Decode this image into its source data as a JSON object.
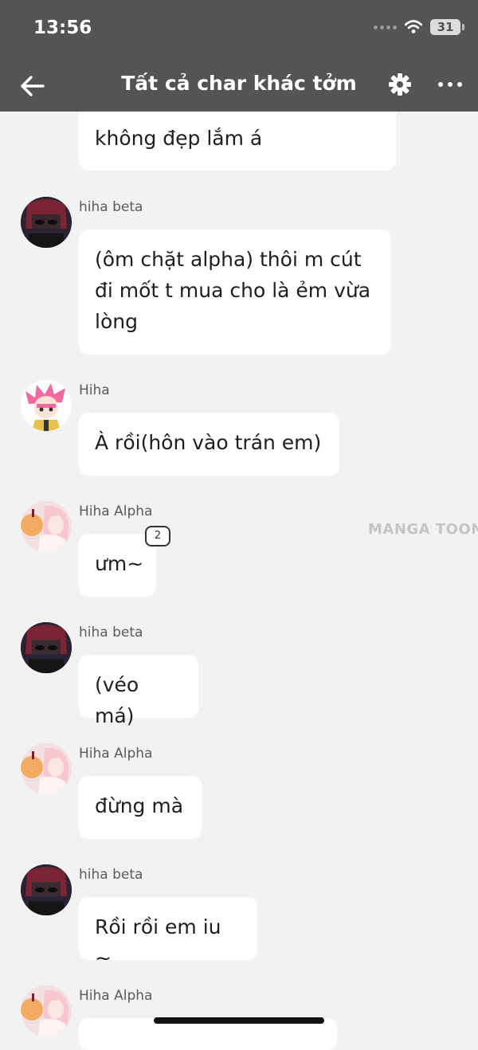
{
  "status_bar": {
    "time": "13:56",
    "battery": "31"
  },
  "header": {
    "title": "Tất cả char khác tởm"
  },
  "messages": [
    {
      "text": "không đẹp lắm á"
    },
    {
      "sender": "hiha beta",
      "text": "(ôm chặt alpha) thôi m cút đi mốt t mua cho là ẻm vừa lòng"
    },
    {
      "sender": "Hiha",
      "text": "À rồi(hôn vào trán em)"
    },
    {
      "sender": "Hiha Alpha",
      "text": "ưm~",
      "badge": "2"
    },
    {
      "sender": "hiha beta",
      "text": "(véo má)"
    },
    {
      "sender": "Hiha Alpha",
      "text": "đừng mà"
    },
    {
      "sender": "hiha beta",
      "text": "Rồi rồi em iu ~"
    },
    {
      "sender": "Hiha Alpha",
      "text": ""
    }
  ],
  "watermark": "MANGA TOON"
}
